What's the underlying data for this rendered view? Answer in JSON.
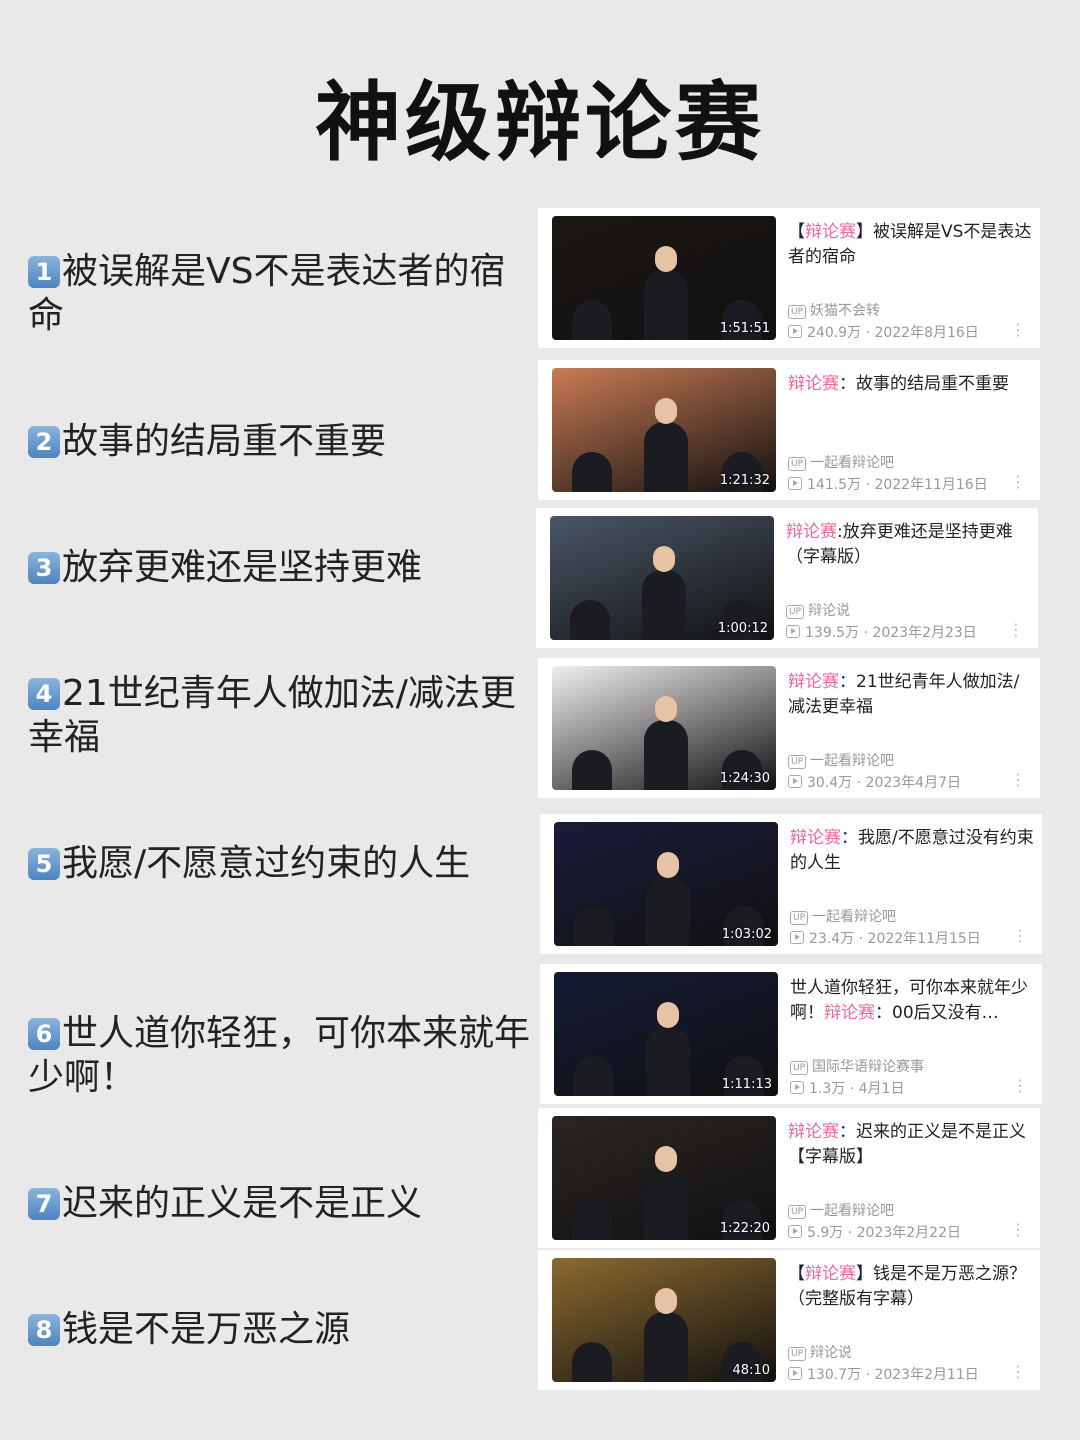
{
  "title": "神级辩论赛",
  "items": [
    {
      "num": "1",
      "text": "被误解是VS不是表达者的宿命",
      "title_prefix": "【",
      "title_tag": "辩论赛",
      "title_rest": "】被误解是VS不是表达者的宿命",
      "uploader": "妖猫不会转",
      "views": "240.9万",
      "date": "2022年8月16日",
      "duration": "1:51:51",
      "thumb": "#1b1712"
    },
    {
      "num": "2",
      "text": "故事的结局重不重要",
      "title_prefix": "",
      "title_tag": "辩论赛",
      "title_rest": "：故事的结局重不重要",
      "uploader": "一起看辩论吧",
      "views": "141.5万",
      "date": "2022年11月16日",
      "duration": "1:21:32",
      "thumb": "#c97b54"
    },
    {
      "num": "3",
      "text": "放弃更难还是坚持更难",
      "title_prefix": "",
      "title_tag": "辩论赛",
      "title_rest": ":放弃更难还是坚持更难（字幕版）",
      "uploader": "辩论说",
      "views": "139.5万",
      "date": "2023年2月23日",
      "duration": "1:00:12",
      "thumb": "#4a5666"
    },
    {
      "num": "4",
      "text": "21世纪青年人做加法/减法更幸福",
      "title_prefix": "",
      "title_tag": "辩论赛",
      "title_rest": "：21世纪青年人做加法/减法更幸福",
      "uploader": "一起看辩论吧",
      "views": "30.4万",
      "date": "2023年4月7日",
      "duration": "1:24:30",
      "thumb": "#f0eeee"
    },
    {
      "num": "5",
      "text": "我愿/不愿意过约束的人生",
      "title_prefix": "",
      "title_tag": "辩论赛",
      "title_rest": "：我愿/不愿意过没有约束的人生",
      "uploader": "一起看辩论吧",
      "views": "23.4万",
      "date": "2022年11月15日",
      "duration": "1:03:02",
      "thumb": "#1a1c3a"
    },
    {
      "num": "6",
      "text": "世人道你轻狂，可你本来就年少啊！",
      "title_prefix": "世人道你轻狂，可你本来就年少啊！",
      "title_tag": "辩论赛",
      "title_rest": "：00后又没有…",
      "uploader": "国际华语辩论赛事",
      "views": "1.3万",
      "date": "4月1日",
      "duration": "1:11:13",
      "thumb": "#141a34"
    },
    {
      "num": "7",
      "text": "迟来的正义是不是正义",
      "title_prefix": "",
      "title_tag": "辩论赛",
      "title_rest": "：迟来的正义是不是正义【字幕版】",
      "uploader": "一起看辩论吧",
      "views": "5.9万",
      "date": "2023年2月22日",
      "duration": "1:22:20",
      "thumb": "#2a2522"
    },
    {
      "num": "8",
      "text": "钱是不是万恶之源",
      "title_prefix": "【",
      "title_tag": "辩论赛",
      "title_rest": "】钱是不是万恶之源？（完整版有字幕）",
      "uploader": "辩论说",
      "views": "130.7万",
      "date": "2023年2月11日",
      "duration": "48:10",
      "thumb": "#8b6a2e"
    }
  ],
  "badge_up": "UP",
  "sep": "·",
  "more_icon": "⋮"
}
